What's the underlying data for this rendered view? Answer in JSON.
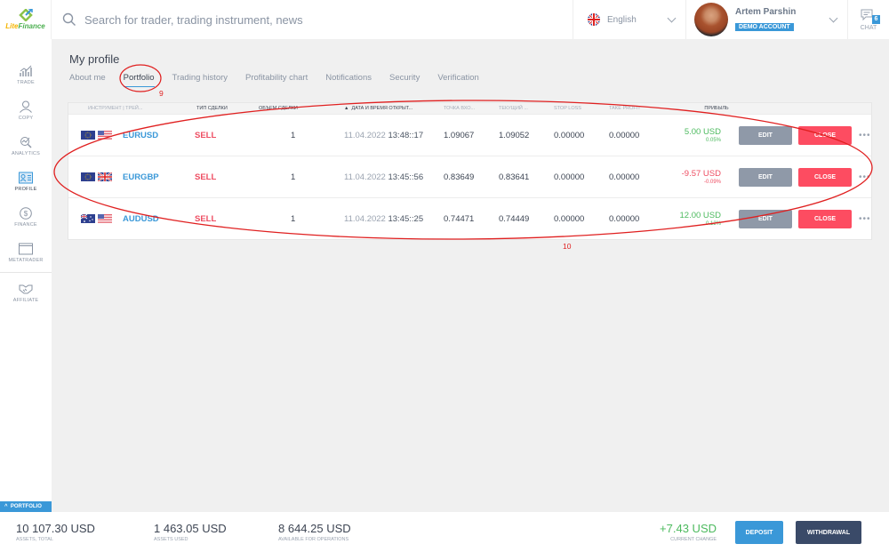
{
  "header": {
    "logo": {
      "part1": "Lite",
      "part2": "Finance"
    },
    "search_placeholder": "Search for trader, trading instrument, news",
    "language": "English",
    "user": {
      "name": "Artem Parshin",
      "badge": "DEMO ACCOUNT"
    },
    "chat": {
      "label": "CHAT",
      "count": "6"
    }
  },
  "sidebar": {
    "items": [
      {
        "label": "TRADE",
        "icon": "chart-icon"
      },
      {
        "label": "COPY",
        "icon": "user-icon"
      },
      {
        "label": "ANALYTICS",
        "icon": "analytics-icon"
      },
      {
        "label": "PROFILE",
        "icon": "id-card-icon",
        "active": true
      },
      {
        "label": "FINANCE",
        "icon": "dollar-icon"
      },
      {
        "label": "METATRADER",
        "icon": "window-icon"
      },
      {
        "label": "AFFILIATE",
        "icon": "handshake-icon"
      }
    ]
  },
  "page": {
    "title": "My profile",
    "tabs": [
      "About me",
      "Portfolio",
      "Trading history",
      "Profitability chart",
      "Notifications",
      "Security",
      "Verification"
    ],
    "active_tab": "Portfolio"
  },
  "table": {
    "columns": [
      "ИНСТРУМЕНТ | ТРЕЙ...",
      "ТИП СДЕЛКИ",
      "ОБЪЕМ СДЕЛКИ",
      "ДАТА И ВРЕМЯ ОТКРЫТ...",
      "ТОЧКА ВХО...",
      "ТЕКУЩИЙ ...",
      "STOP LOSS",
      "TAKE PROFIT",
      "ПРИБЫЛЬ"
    ],
    "sort_indicator": "▲",
    "rows": [
      {
        "instrument": "EURUSD",
        "flags": [
          "eu",
          "us"
        ],
        "type": "SELL",
        "volume": "1",
        "date": "11.04.2022",
        "time": "13:48::17",
        "entry": "1.09067",
        "current": "1.09052",
        "stop_loss": "0.00000",
        "take_profit": "0.00000",
        "profit": "5.00 USD",
        "profit_pct": "0.05%",
        "profit_sign": "pos"
      },
      {
        "instrument": "EURGBP",
        "flags": [
          "eu",
          "gb"
        ],
        "type": "SELL",
        "volume": "1",
        "date": "11.04.2022",
        "time": "13:45::56",
        "entry": "0.83649",
        "current": "0.83641",
        "stop_loss": "0.00000",
        "take_profit": "0.00000",
        "profit": "-9.57 USD",
        "profit_pct": "-0.09%",
        "profit_sign": "neg"
      },
      {
        "instrument": "AUDUSD",
        "flags": [
          "au",
          "us"
        ],
        "type": "SELL",
        "volume": "1",
        "date": "11.04.2022",
        "time": "13:45::25",
        "entry": "0.74471",
        "current": "0.74449",
        "stop_loss": "0.00000",
        "take_profit": "0.00000",
        "profit": "12.00 USD",
        "profit_pct": "0.12%",
        "profit_sign": "pos"
      }
    ],
    "edit_label": "EDIT",
    "close_label": "CLOSE",
    "more_label": "•••"
  },
  "annotations": {
    "tab_marker": "9",
    "table_marker": "10"
  },
  "footer": {
    "portfolio_toggle": "PORTFOLIO",
    "assets_total": {
      "value": "10 107.30 USD",
      "label": "ASSETS, TOTAL"
    },
    "assets_used": {
      "value": "1 463.05 USD",
      "label": "ASSETS USED"
    },
    "available": {
      "value": "8 644.25 USD",
      "label": "AVAILABLE FOR OPERATIONS"
    },
    "current_change": {
      "value": "+7.43 USD",
      "label": "CURRENT CHANGE"
    },
    "deposit_label": "DEPOSIT",
    "withdrawal_label": "WITHDRAWAL"
  },
  "colors": {
    "accent": "#3a98d8",
    "sell": "#ee4d62",
    "profit_pos": "#4cba5e",
    "close_btn": "#fd4c61",
    "edit_btn": "#8f99a8",
    "withdraw_btn": "#3a4a68",
    "annotation": "#e02020"
  }
}
